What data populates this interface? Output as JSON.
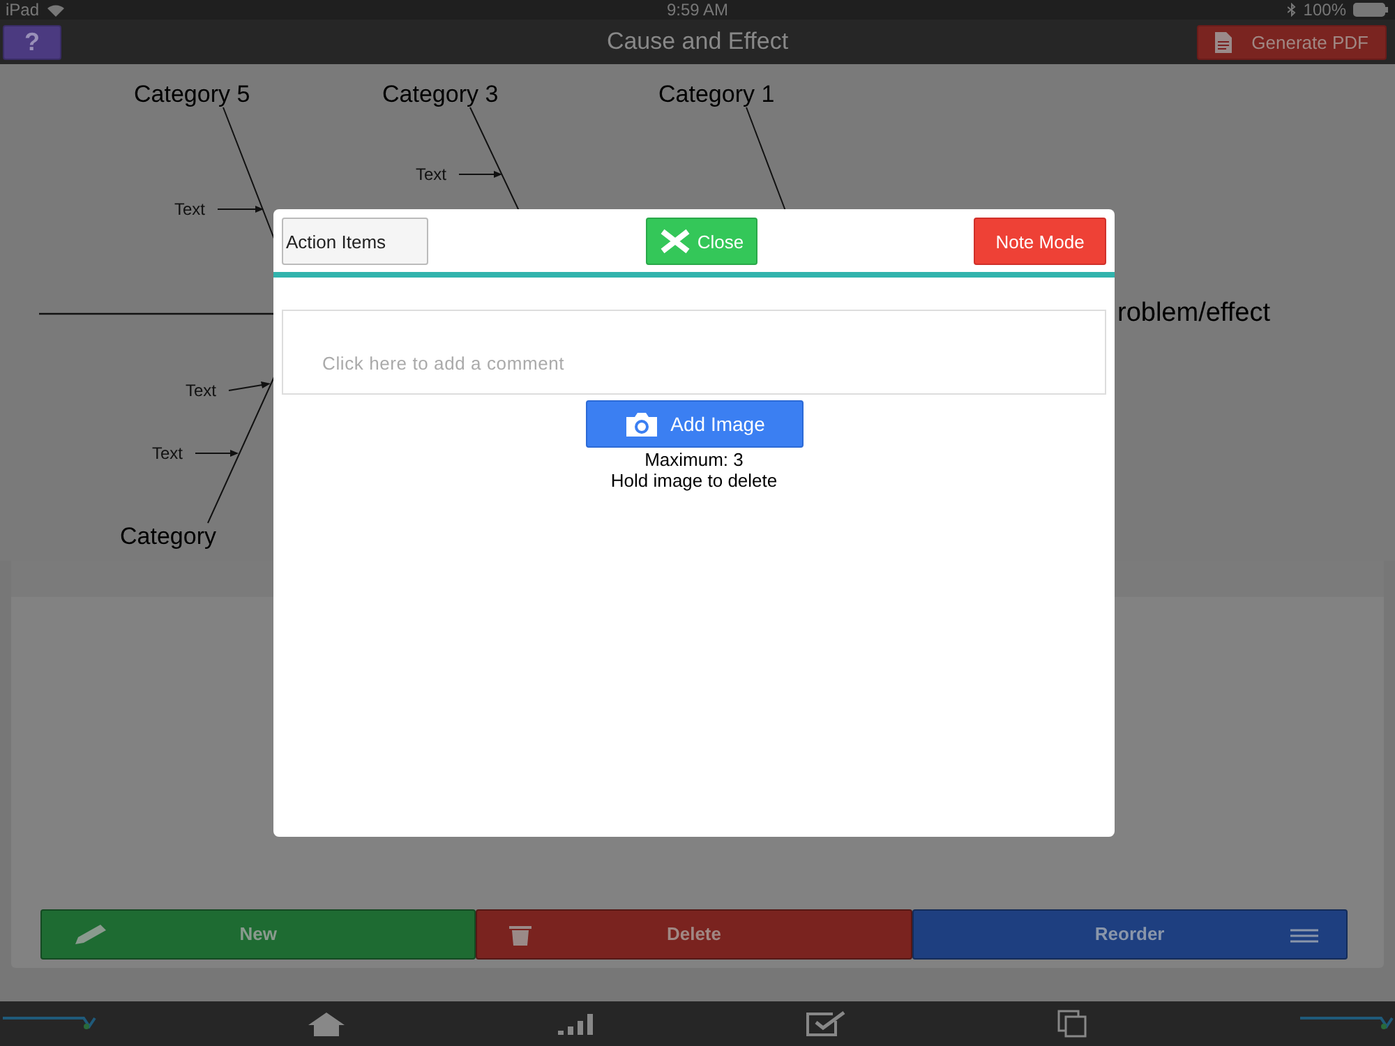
{
  "status_bar": {
    "carrier": "iPad",
    "time": "9:59 AM",
    "battery": "100%"
  },
  "nav_bar": {
    "help_button": "?",
    "title": "Cause and Effect",
    "pdf_button": "Generate PDF"
  },
  "diagram": {
    "categories": [
      "Category 5",
      "Category 3",
      "Category 1",
      "Category"
    ],
    "causes": [
      "Text",
      "Text",
      "Text",
      "Text"
    ],
    "effect": "roblem/effect"
  },
  "list_panel": {
    "buttons": [
      {
        "kind": "new",
        "label": "New"
      },
      {
        "kind": "delete",
        "label": "Delete"
      },
      {
        "kind": "reorder",
        "label": "Reorder"
      }
    ]
  },
  "tab_bar": {
    "items": [
      {
        "kind": "logo"
      },
      {
        "kind": "home"
      },
      {
        "kind": "chart"
      },
      {
        "kind": "check"
      },
      {
        "kind": "pages"
      },
      {
        "kind": "logo"
      }
    ]
  },
  "modal": {
    "action_items_button": "Action Items",
    "close_button": "Close",
    "note_mode_button": "Note Mode",
    "comment": {
      "placeholder": "Click here to add a comment"
    },
    "add_image_button": "Add Image",
    "max_hint": "Maximum: 3",
    "delete_hint": "Hold image to delete"
  }
}
